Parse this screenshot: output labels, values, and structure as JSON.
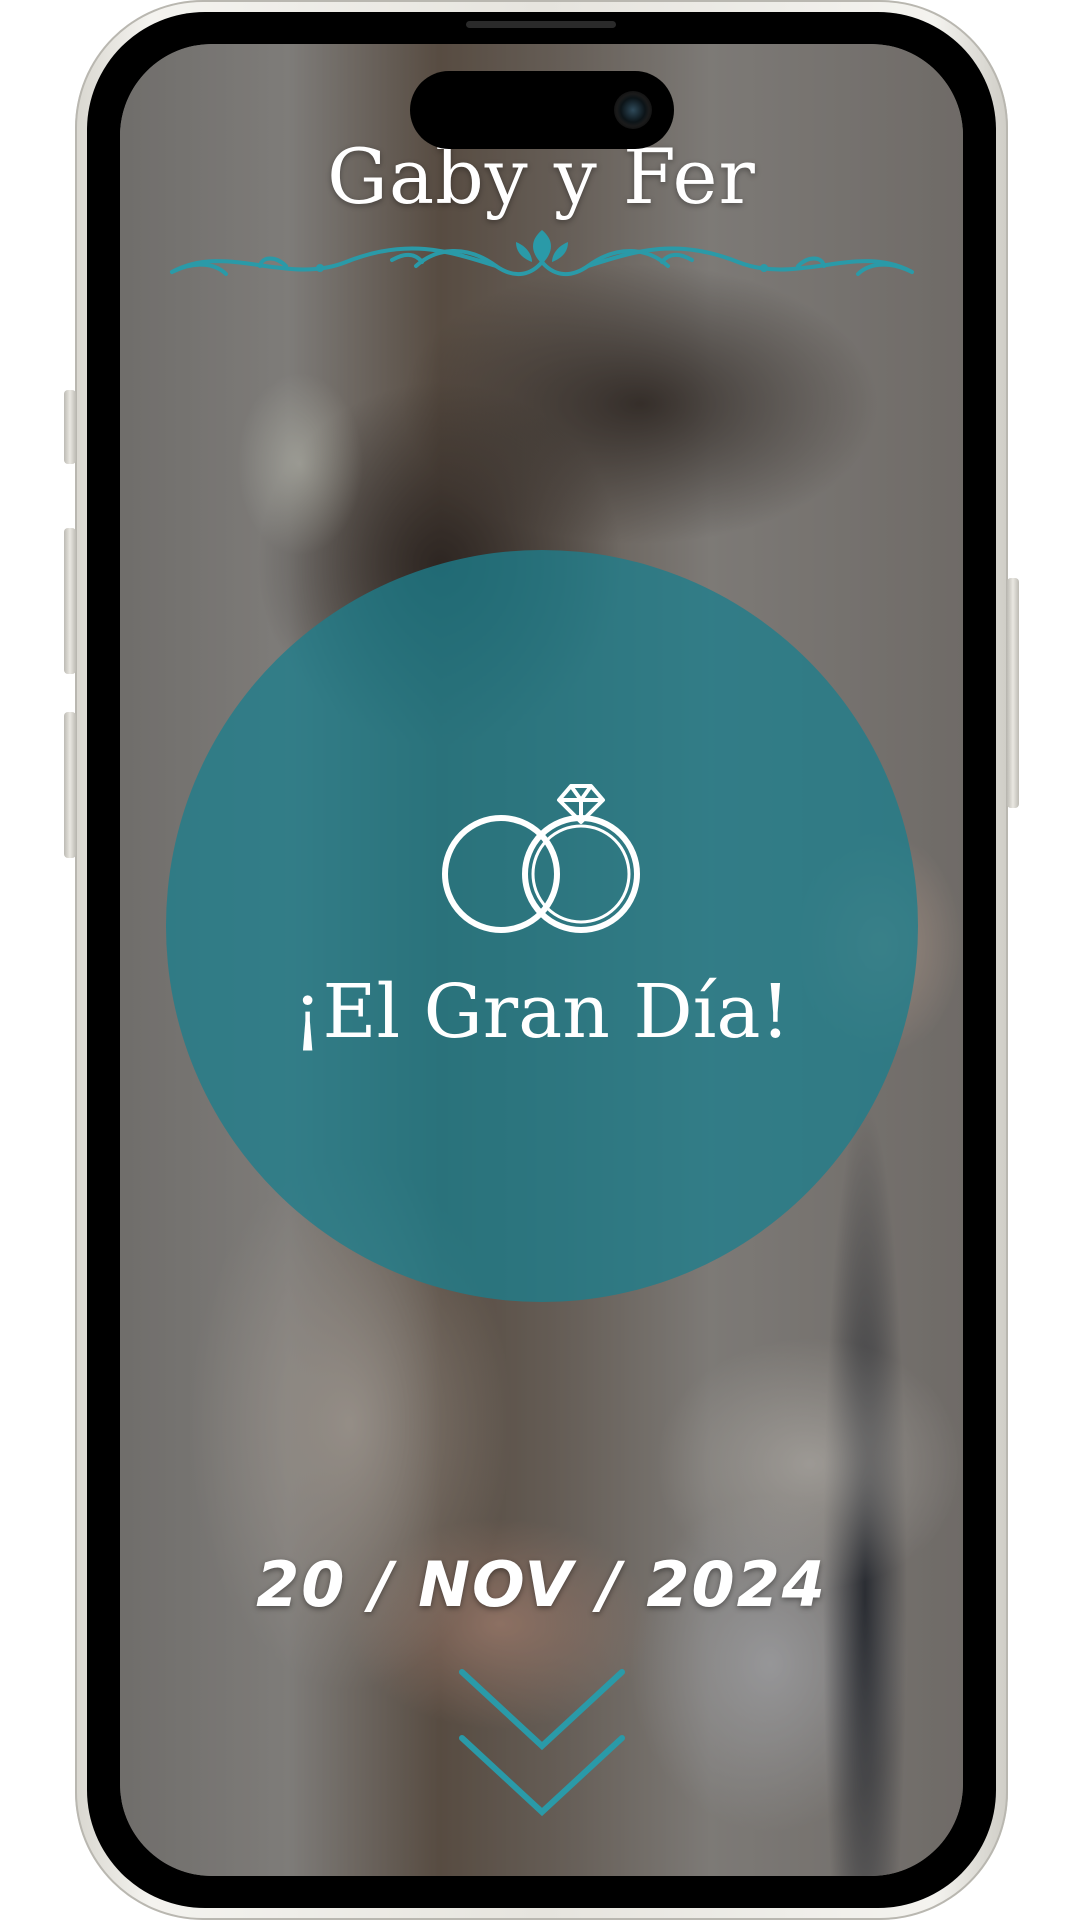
{
  "invitation": {
    "couple_names": "Gaby y Fer",
    "headline": "¡El Gran Día!",
    "date": "20 / NOV / 2024"
  },
  "icons": {
    "rings": "wedding-rings-icon",
    "flourish": "ornamental-divider-icon",
    "scroll": "double-chevron-down-icon"
  },
  "colors": {
    "accent": "#2a9aa8",
    "circle_overlay": "#1e7d8c",
    "text": "#ffffff"
  }
}
